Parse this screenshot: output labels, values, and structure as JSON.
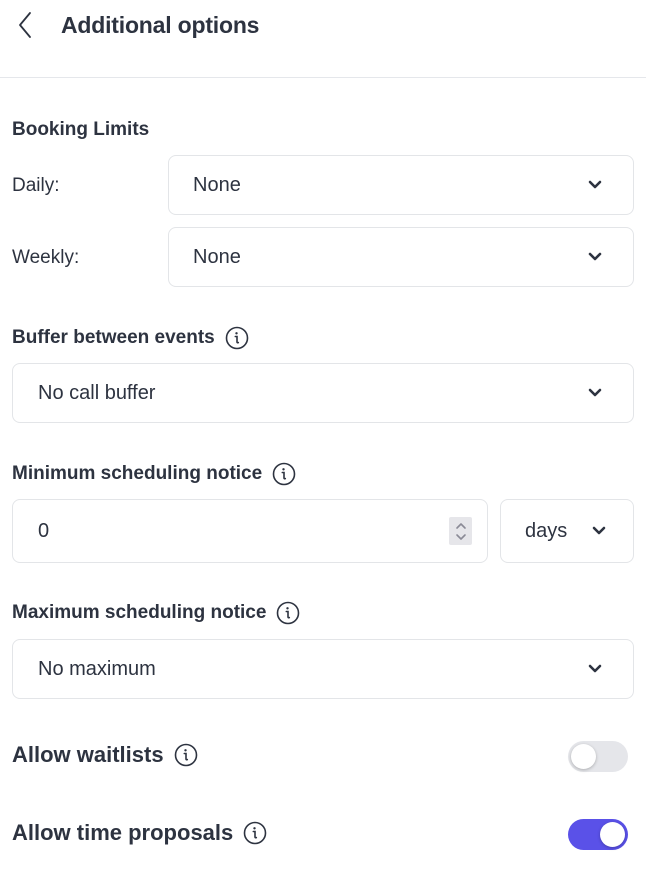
{
  "header": {
    "title": "Additional options",
    "back_icon": "chevron-left-icon"
  },
  "booking_limits": {
    "title": "Booking Limits",
    "daily": {
      "label": "Daily:",
      "value": "None"
    },
    "weekly": {
      "label": "Weekly:",
      "value": "None"
    }
  },
  "buffer": {
    "title": "Buffer between events",
    "value": "No call buffer"
  },
  "min_notice": {
    "title": "Minimum scheduling notice",
    "amount": "0",
    "unit": "days"
  },
  "max_notice": {
    "title": "Maximum scheduling notice",
    "value": "No maximum"
  },
  "waitlists": {
    "label": "Allow waitlists",
    "enabled": false
  },
  "time_proposals": {
    "label": "Allow time proposals",
    "enabled": true
  },
  "colors": {
    "accent": "#5a51e8",
    "text": "#2d3340",
    "border": "#e3e5e8",
    "toggle_off": "#e5e6ea"
  }
}
